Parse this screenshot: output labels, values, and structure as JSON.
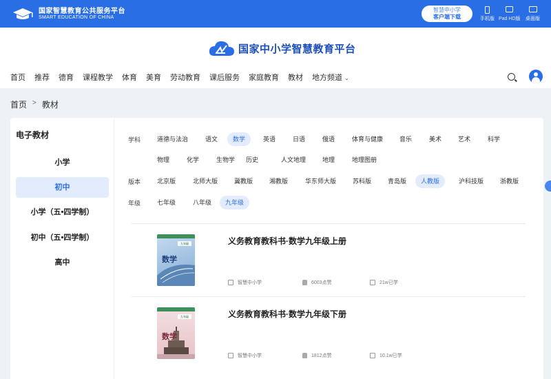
{
  "topbar": {
    "brand_cn": "国家智慧教育公共服务平台",
    "brand_en": "SMART EDUCATION OF CHINA",
    "client_line1": "智慧中小学",
    "client_line2": "客户端下载",
    "devices": [
      "手机版",
      "Pad HD版",
      "桌面版"
    ]
  },
  "header": {
    "site_title": "国家中小学智慧教育平台",
    "nav": [
      "首页",
      "推荐",
      "德育",
      "课程教学",
      "体育",
      "美育",
      "劳动教育",
      "课后服务",
      "家庭教育",
      "教材",
      "地方频道"
    ]
  },
  "breadcrumb": [
    "首页",
    "教材"
  ],
  "breadcrumb_sep": ">",
  "sidebar": {
    "title": "电子教材",
    "items": [
      "小学",
      "初中",
      "小学（五•四学制）",
      "初中（五•四学制）",
      "高中"
    ],
    "active_index": 1
  },
  "filters": {
    "subject_label": "学科",
    "subjects_row1": [
      "道德与法治",
      "语文",
      "数学",
      "英语",
      "日语",
      "俄语",
      "体育与健康",
      "音乐",
      "美术",
      "艺术",
      "科学"
    ],
    "subjects_row2": [
      "物理",
      "化学",
      "生物学",
      "历史",
      "人文地理",
      "地理",
      "地理图册"
    ],
    "subject_selected": "数学",
    "edition_label": "版本",
    "editions": [
      "北京版",
      "北师大版",
      "冀教版",
      "湘教版",
      "华东师大版",
      "苏科版",
      "青岛版",
      "人教版",
      "沪科技版",
      "浙教版"
    ],
    "edition_selected": "人教版",
    "grade_label": "年级",
    "grades": [
      "七年级",
      "八年级",
      "九年级"
    ],
    "grade_selected": "九年级"
  },
  "books": [
    {
      "title": "义务教育教科书·数学九年级上册",
      "source": "智慧中小学",
      "likes": "6003点赞",
      "learners": "21w已学",
      "cover_text": "数学",
      "cover_badge": "九年级",
      "cover_colors": [
        "#7fa9d6",
        "#c7dcef"
      ]
    },
    {
      "title": "义务教育教科书·数学九年级下册",
      "source": "智慧中小学",
      "likes": "1812点赞",
      "learners": "10.1w已学",
      "cover_text": "数学",
      "cover_badge": "九年级",
      "cover_colors": [
        "#e8c2c8",
        "#f3dfe2"
      ]
    }
  ],
  "colors": {
    "accent": "#2a6ee6",
    "selected_bg": "#e3ecfc"
  }
}
